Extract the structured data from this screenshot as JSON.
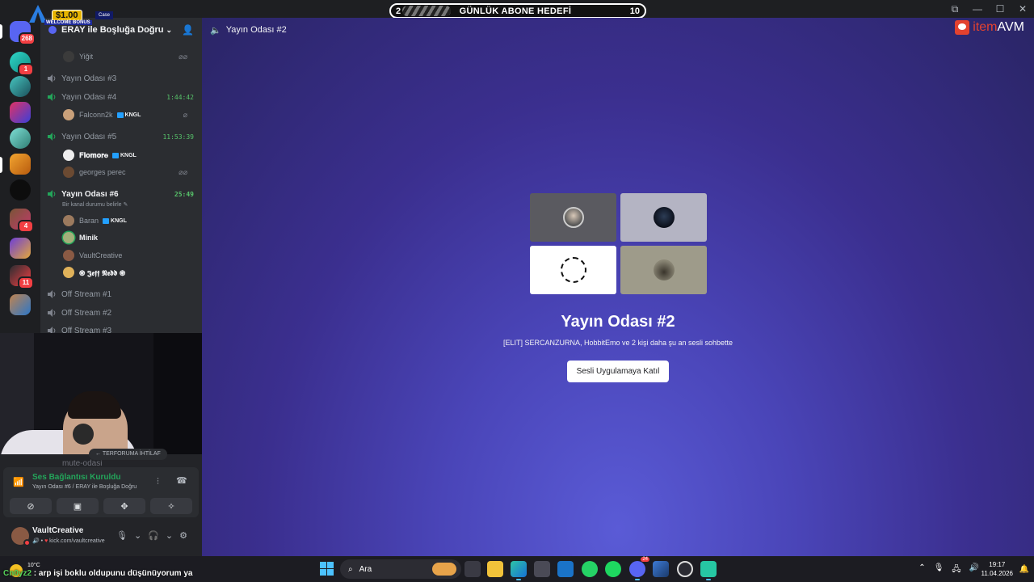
{
  "overlay": {
    "promo_amount": "$1.00",
    "promo_text": "WELCOME BONUS",
    "promo_brand": "Case",
    "goal_start": "2",
    "goal_title": "GÜNLÜK ABONE HEDEFİ",
    "goal_end": "10"
  },
  "rail": {
    "home_badge": "268",
    "badges": [
      "1",
      "4",
      "11"
    ]
  },
  "sidebar": {
    "server_name": "ERAY ile Boşluğa Doğru",
    "channels": [
      {
        "name": "Yayın Odası #3",
        "timer": ""
      },
      {
        "name": "Yayın Odası #4",
        "timer": "1:44:42"
      },
      {
        "name": "Yayın Odası #5",
        "timer": "11:53:39"
      },
      {
        "name": "Yayın Odası #6",
        "timer": "25:49",
        "status": "Bir kanal durumu belirle"
      },
      {
        "name": "Off Stream #1"
      },
      {
        "name": "Off Stream #2"
      },
      {
        "name": "Off Stream #3"
      }
    ],
    "users": [
      {
        "name": "Yiğit"
      },
      {
        "name": "Falconn2k",
        "tag": "KNGL"
      },
      {
        "name": "𝐅𝐥𝐨𝐦𝐨𝐫𝐞",
        "tag": "KNGL"
      },
      {
        "name": "georges perec"
      },
      {
        "name": "Baran",
        "tag": "KNGL"
      },
      {
        "name": "Minik"
      },
      {
        "name": "VaultCreative"
      },
      {
        "name": "֎ 𝕵𝖊𝖋𝖋 𝕹𝖊𝖉𝖉 ֎"
      }
    ],
    "muted_channel": "mute-odasi",
    "conduct_tag": "← TERFORUMA İHTİLAF"
  },
  "voice": {
    "title": "Ses Bağlantısı Kuruldu",
    "subtitle": "Yayın Odası #6 / ERAY ile Boşluğa Doğru"
  },
  "me": {
    "name": "VaultCreative",
    "status": "kick.com/vaultcreative"
  },
  "main": {
    "channel": "Yayın Odası #2",
    "room_title": "Yayın Odası #2",
    "room_sub": "[ELIT] SERCANZURNA, HobbitEmo ve 2 kişi daha şu an sesli sohbette",
    "join_button": "Sesli Uygulamaya Katıl",
    "logo_item": "item",
    "logo_avm": "AVM"
  },
  "taskbar": {
    "weather_temp": "10°C",
    "search": "Ara",
    "time": "19:17",
    "date": "11.04.2026",
    "app_badge": "24"
  },
  "chat": {
    "user": "Cn0yz2",
    "message": "arp işi boklu oldupunu düşünüyorum ya"
  },
  "colors": {
    "online": "#23a55a",
    "timer": "#57c26a",
    "accent": "#5865f2",
    "notification": "#f23f43"
  }
}
